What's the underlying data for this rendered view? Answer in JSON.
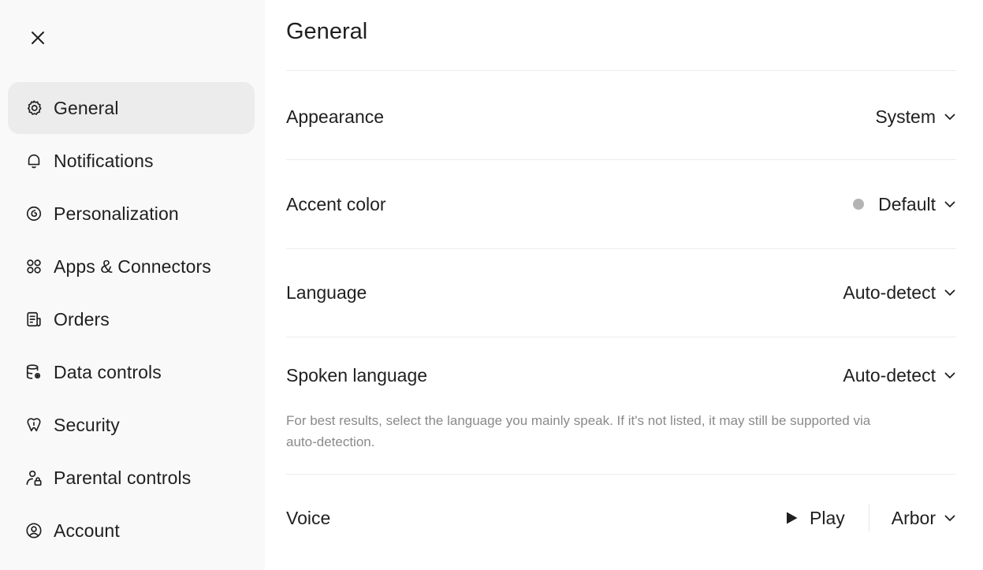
{
  "sidebar": {
    "items": [
      {
        "id": "general",
        "label": "General",
        "icon": "gear-icon",
        "active": true
      },
      {
        "id": "notifications",
        "label": "Notifications",
        "icon": "bell-icon",
        "active": false
      },
      {
        "id": "personalization",
        "label": "Personalization",
        "icon": "personalization-icon",
        "active": false
      },
      {
        "id": "apps-connectors",
        "label": "Apps & Connectors",
        "icon": "apps-icon",
        "active": false
      },
      {
        "id": "orders",
        "label": "Orders",
        "icon": "orders-icon",
        "active": false
      },
      {
        "id": "data-controls",
        "label": "Data controls",
        "icon": "database-gear-icon",
        "active": false
      },
      {
        "id": "security",
        "label": "Security",
        "icon": "security-icon",
        "active": false
      },
      {
        "id": "parental-controls",
        "label": "Parental controls",
        "icon": "parental-icon",
        "active": false
      },
      {
        "id": "account",
        "label": "Account",
        "icon": "account-icon",
        "active": false
      }
    ]
  },
  "main": {
    "title": "General",
    "settings": {
      "appearance": {
        "label": "Appearance",
        "value": "System"
      },
      "accent_color": {
        "label": "Accent color",
        "value": "Default",
        "dot_color": "#b4b4b4"
      },
      "language": {
        "label": "Language",
        "value": "Auto-detect"
      },
      "spoken_language": {
        "label": "Spoken language",
        "value": "Auto-detect",
        "help": "For best results, select the language you mainly speak. If it's not listed, it may still be supported via auto-detection."
      },
      "voice": {
        "label": "Voice",
        "play_label": "Play",
        "value": "Arbor"
      }
    }
  },
  "colors": {
    "sidebar_bg": "#f9f9f9",
    "active_item_bg": "#ececec",
    "text": "#1f1f1f",
    "muted_text": "#8a8a8a",
    "divider": "#ececec"
  }
}
